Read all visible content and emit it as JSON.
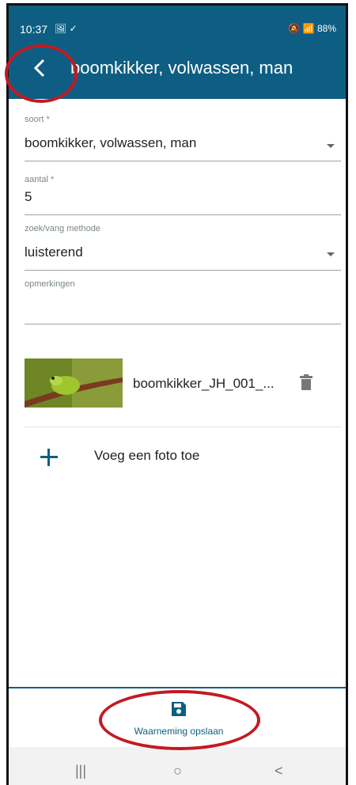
{
  "status": {
    "time": "10:37",
    "icons_left": "🖼 ✓",
    "right": "🔕 📶 88%"
  },
  "app_bar": {
    "title": "boomkikker, volwassen, man"
  },
  "form": {
    "soort": {
      "label": "soort *",
      "value": "boomkikker, volwassen, man"
    },
    "aantal": {
      "label": "aantal *",
      "value": "5"
    },
    "methode": {
      "label": "zoek/vang methode",
      "value": "luisterend"
    },
    "opmerkingen": {
      "label": "opmerkingen",
      "value": ""
    }
  },
  "photos": [
    {
      "name": "boomkikker_JH_001_..."
    }
  ],
  "add_photo": {
    "label": "Voeg een foto toe"
  },
  "bottom": {
    "save_label": "Waarneming opslaan"
  },
  "nav": {
    "recent": "|||",
    "home": "○",
    "back": "<"
  },
  "colors": {
    "primary": "#0e5e83",
    "annotation": "#c31a22"
  }
}
